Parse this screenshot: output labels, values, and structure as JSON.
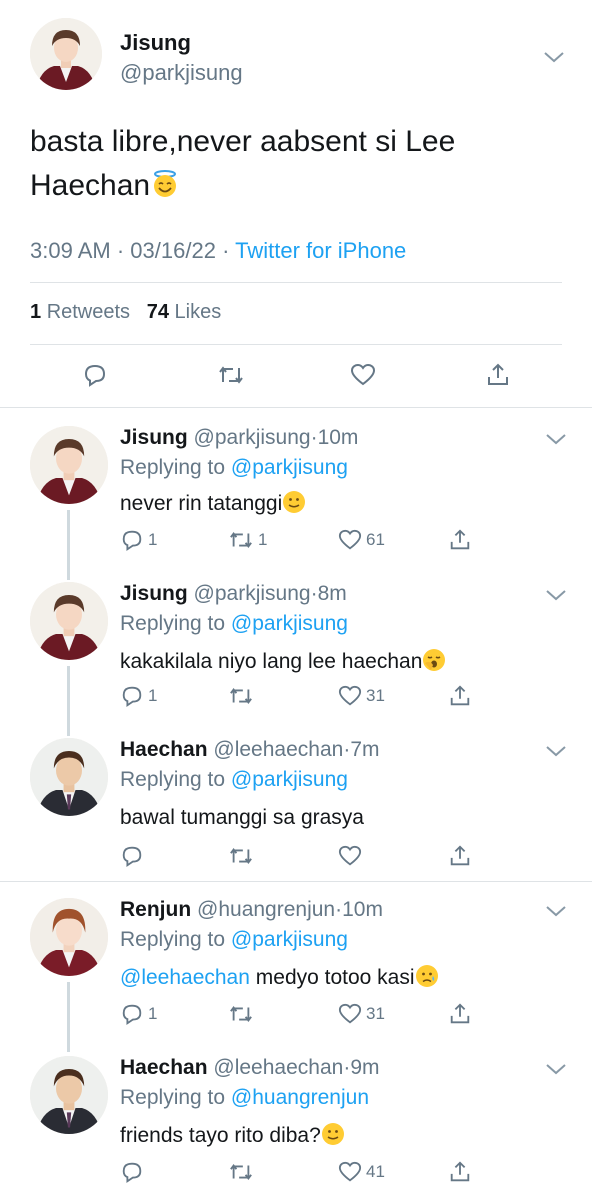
{
  "main_tweet": {
    "name": "Jisung",
    "handle": "@parkjisung",
    "text": "basta libre,never aabsent si Lee Haechan",
    "time": "3:09 AM",
    "date": "03/16/22",
    "source": "Twitter for iPhone",
    "retweets_count": "1",
    "retweets_label": "Retweets",
    "likes_count": "74",
    "likes_label": "Likes"
  },
  "replies": [
    {
      "name": "Jisung",
      "handle": "@parkjisung",
      "time": "10m",
      "replying_label": "Replying to",
      "replying_to": "@parkjisung",
      "mention": "",
      "text": "never rin tatanggi",
      "reply_count": "1",
      "retweet_count": "1",
      "like_count": "61"
    },
    {
      "name": "Jisung",
      "handle": "@parkjisung",
      "time": "8m",
      "replying_label": "Replying to",
      "replying_to": "@parkjisung",
      "mention": "",
      "text": "kakakilala niyo lang lee haechan",
      "reply_count": "1",
      "retweet_count": "",
      "like_count": "31"
    },
    {
      "name": "Haechan",
      "handle": "@leehaechan",
      "time": "7m",
      "replying_label": "Replying to",
      "replying_to": "@parkjisung",
      "mention": "",
      "text": "bawal tumanggi sa grasya",
      "reply_count": "",
      "retweet_count": "",
      "like_count": ""
    },
    {
      "name": "Renjun",
      "handle": "@huangrenjun",
      "time": "10m",
      "replying_label": "Replying to",
      "replying_to": "@parkjisung",
      "mention": "@leehaechan",
      "text": "medyo totoo kasi",
      "reply_count": "1",
      "retweet_count": "",
      "like_count": "31"
    },
    {
      "name": "Haechan",
      "handle": "@leehaechan",
      "time": "9m",
      "replying_label": "Replying to",
      "replying_to": "@huangrenjun",
      "mention": "",
      "text": "friends tayo rito diba?",
      "reply_count": "",
      "retweet_count": "",
      "like_count": "41"
    }
  ],
  "icons": {
    "reply": "reply-icon",
    "retweet": "retweet-icon",
    "like": "heart-icon",
    "share": "share-icon",
    "more": "chevron-down-icon"
  },
  "colors": {
    "link": "#1da1f2",
    "secondary": "#657786",
    "text": "#14171a"
  }
}
